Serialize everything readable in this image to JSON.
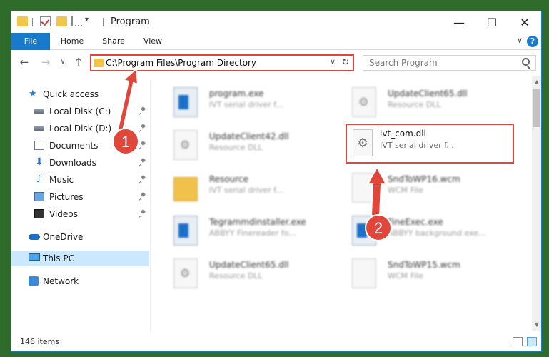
{
  "window": {
    "title": "Program",
    "controls": {
      "minimize": "—",
      "maximize": "☐",
      "close": "✕"
    }
  },
  "ribbon": {
    "tabs": [
      "File",
      "Home",
      "Share",
      "View"
    ],
    "help": "?",
    "collapse": "∨"
  },
  "nav": {
    "back": "←",
    "forward": "→",
    "recent": "∨",
    "up": "↑",
    "address": "C:\\Program Files\\Program Directory",
    "address_chevron": "∨",
    "refresh": "↻",
    "search_placeholder": "Search Program"
  },
  "sidebar": {
    "items": [
      {
        "label": "Quick access",
        "icon": "star-icon"
      },
      {
        "label": "Local Disk (C:)",
        "icon": "drive-icon",
        "pinned": true
      },
      {
        "label": "Local Disk (D:)",
        "icon": "drive-icon",
        "pinned": true
      },
      {
        "label": "Documents",
        "icon": "documents-icon",
        "pinned": true
      },
      {
        "label": "Downloads",
        "icon": "downloads-icon",
        "pinned": true
      },
      {
        "label": "Music",
        "icon": "music-icon",
        "pinned": true
      },
      {
        "label": "Pictures",
        "icon": "pictures-icon",
        "pinned": true
      },
      {
        "label": "Videos",
        "icon": "videos-icon",
        "pinned": true
      },
      {
        "label": "OneDrive",
        "icon": "cloud-icon"
      },
      {
        "label": "This PC",
        "icon": "computer-icon",
        "selected": true
      },
      {
        "label": "Network",
        "icon": "network-icon"
      }
    ]
  },
  "files": [
    {
      "name": "program.exe",
      "desc": "IVT serial driver f...",
      "icon": "app-icon"
    },
    {
      "name": "UpdateClient65.dll",
      "desc": "Resource DLL",
      "icon": "dll-icon"
    },
    {
      "name": "UpdateClient42.dll",
      "desc": "Resource DLL",
      "icon": "dll-icon"
    },
    {
      "name": "Resource",
      "desc": "IVT serial driver f...",
      "icon": "folder-icon"
    },
    {
      "name": "SndToWP16.wcm",
      "desc": "WCM File",
      "icon": "file-icon"
    },
    {
      "name": "Tegrammdinstaller.exe",
      "desc": "ABBYY Finereader fo...",
      "icon": "app-icon"
    },
    {
      "name": "FineExec.exe",
      "desc": "ABBYY background exe...",
      "icon": "app-icon"
    },
    {
      "name": "UpdateClient65.dll",
      "desc": "Resource DLL",
      "icon": "dll-icon"
    },
    {
      "name": "SndToWP15.wcm",
      "desc": "WCM File",
      "icon": "file-icon"
    }
  ],
  "highlighted_file": {
    "name": "ivt_com.dll",
    "desc": "IVT serial driver f...",
    "icon": "dll-gear-icon"
  },
  "annotations": {
    "step1": "1",
    "step2": "2"
  },
  "status": {
    "item_count": "146 items"
  },
  "colors": {
    "accent": "#1979ca",
    "annotation": "#e0463a",
    "selected": "#cce8ff"
  }
}
